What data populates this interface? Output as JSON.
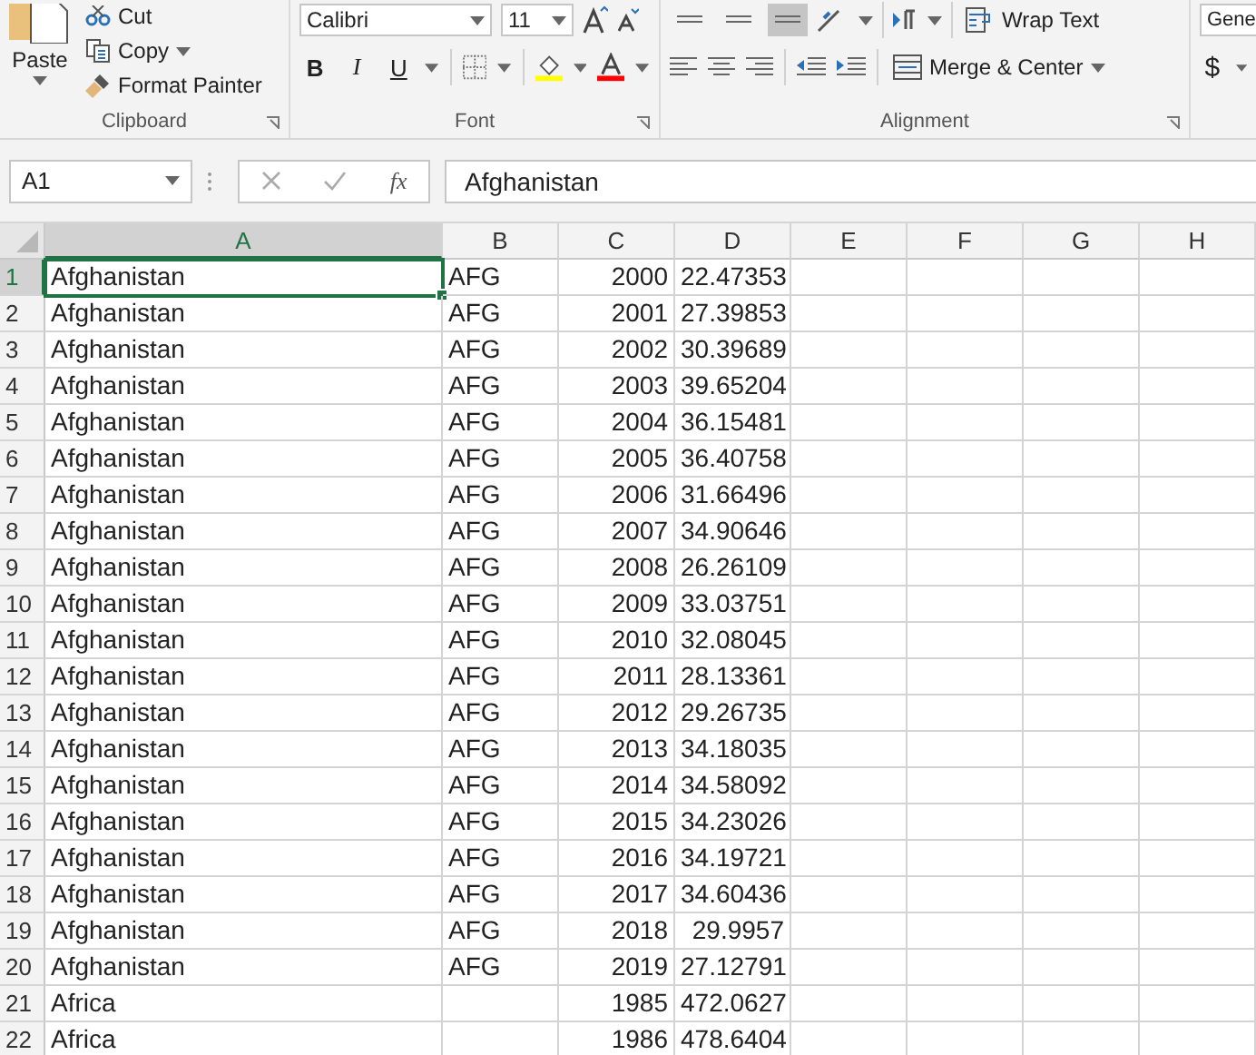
{
  "ribbon": {
    "clipboard": {
      "paste": "Paste",
      "cut": "Cut",
      "copy": "Copy",
      "format_painter": "Format Painter",
      "label": "Clipboard"
    },
    "font": {
      "font_name": "Calibri",
      "font_size": "11",
      "bold": "B",
      "italic": "I",
      "underline": "U",
      "label": "Font"
    },
    "alignment": {
      "vertical_align": [
        {
          "selected": false
        },
        {
          "selected": false
        },
        {
          "selected": true
        }
      ],
      "wrap_text": "Wrap Text",
      "merge_center": "Merge & Center",
      "label": "Alignment"
    },
    "number": {
      "format": "Gene",
      "currency": "$"
    }
  },
  "formula_bar": {
    "name_box": "A1",
    "function_label": "fx",
    "content": "Afghanistan"
  },
  "sheet": {
    "columns": [
      {
        "label": "A",
        "selected": true
      },
      {
        "label": "B",
        "selected": false
      },
      {
        "label": "C",
        "selected": false
      },
      {
        "label": "D",
        "selected": false
      },
      {
        "label": "E",
        "selected": false
      },
      {
        "label": "F",
        "selected": false
      },
      {
        "label": "G",
        "selected": false
      },
      {
        "label": "H",
        "selected": false
      }
    ],
    "rows": [
      {
        "number": "1",
        "selected": true,
        "cells": [
          "Afghanistan",
          "AFG",
          "2000",
          "22.47353"
        ]
      },
      {
        "number": "2",
        "selected": false,
        "cells": [
          "Afghanistan",
          "AFG",
          "2001",
          "27.39853"
        ]
      },
      {
        "number": "3",
        "selected": false,
        "cells": [
          "Afghanistan",
          "AFG",
          "2002",
          "30.39689"
        ]
      },
      {
        "number": "4",
        "selected": false,
        "cells": [
          "Afghanistan",
          "AFG",
          "2003",
          "39.65204"
        ]
      },
      {
        "number": "5",
        "selected": false,
        "cells": [
          "Afghanistan",
          "AFG",
          "2004",
          "36.15481"
        ]
      },
      {
        "number": "6",
        "selected": false,
        "cells": [
          "Afghanistan",
          "AFG",
          "2005",
          "36.40758"
        ]
      },
      {
        "number": "7",
        "selected": false,
        "cells": [
          "Afghanistan",
          "AFG",
          "2006",
          "31.66496"
        ]
      },
      {
        "number": "8",
        "selected": false,
        "cells": [
          "Afghanistan",
          "AFG",
          "2007",
          "34.90646"
        ]
      },
      {
        "number": "9",
        "selected": false,
        "cells": [
          "Afghanistan",
          "AFG",
          "2008",
          "26.26109"
        ]
      },
      {
        "number": "10",
        "selected": false,
        "cells": [
          "Afghanistan",
          "AFG",
          "2009",
          "33.03751"
        ]
      },
      {
        "number": "11",
        "selected": false,
        "cells": [
          "Afghanistan",
          "AFG",
          "2010",
          "32.08045"
        ]
      },
      {
        "number": "12",
        "selected": false,
        "cells": [
          "Afghanistan",
          "AFG",
          "2011",
          "28.13361"
        ]
      },
      {
        "number": "13",
        "selected": false,
        "cells": [
          "Afghanistan",
          "AFG",
          "2012",
          "29.26735"
        ]
      },
      {
        "number": "14",
        "selected": false,
        "cells": [
          "Afghanistan",
          "AFG",
          "2013",
          "34.18035"
        ]
      },
      {
        "number": "15",
        "selected": false,
        "cells": [
          "Afghanistan",
          "AFG",
          "2014",
          "34.58092"
        ]
      },
      {
        "number": "16",
        "selected": false,
        "cells": [
          "Afghanistan",
          "AFG",
          "2015",
          "34.23026"
        ]
      },
      {
        "number": "17",
        "selected": false,
        "cells": [
          "Afghanistan",
          "AFG",
          "2016",
          "34.19721"
        ]
      },
      {
        "number": "18",
        "selected": false,
        "cells": [
          "Afghanistan",
          "AFG",
          "2017",
          "34.60436"
        ]
      },
      {
        "number": "19",
        "selected": false,
        "cells": [
          "Afghanistan",
          "AFG",
          "2018",
          "29.9957"
        ]
      },
      {
        "number": "20",
        "selected": false,
        "cells": [
          "Afghanistan",
          "AFG",
          "2019",
          "27.12791"
        ]
      },
      {
        "number": "21",
        "selected": false,
        "cells": [
          "Africa",
          "",
          "1985",
          "472.0627"
        ]
      },
      {
        "number": "22",
        "selected": false,
        "cells": [
          "Africa",
          "",
          "1986",
          "478.6404"
        ]
      }
    ]
  }
}
